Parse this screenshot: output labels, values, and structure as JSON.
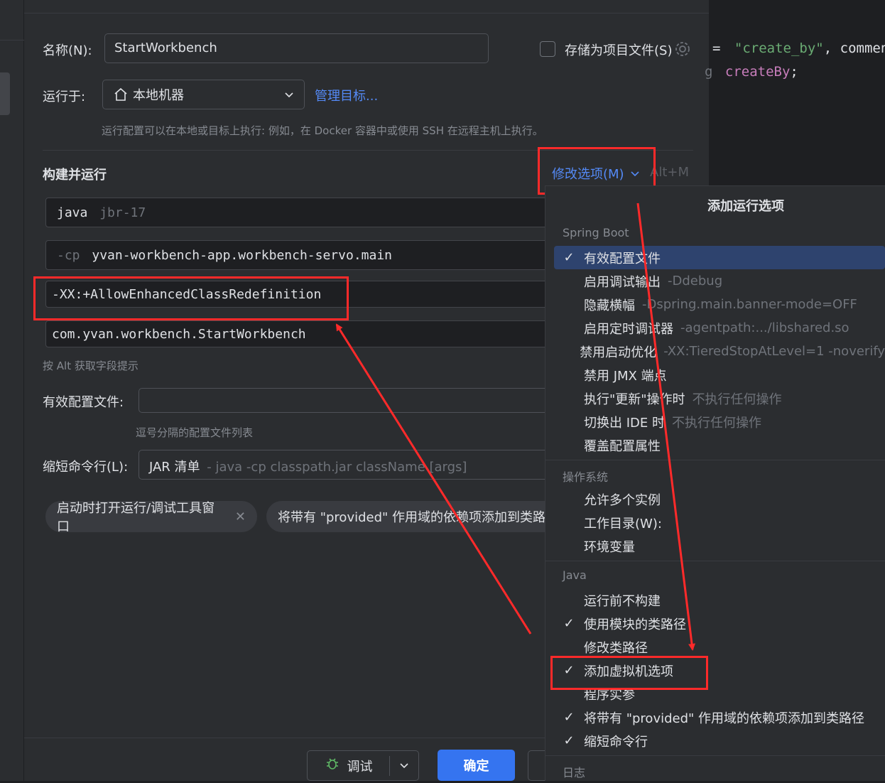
{
  "dialog": {
    "name_label": "名称(N):",
    "name_value": "StartWorkbench",
    "store_label": "存储为项目文件(S)",
    "run_on_label": "运行于:",
    "run_on_value": "本地机器",
    "manage_targets": "管理目标...",
    "run_on_hint": "运行配置可以在本地或目标上执行: 例如，在 Docker 容器中或使用 SSH 在远程主机上执行。",
    "build_run_title": "构建并运行",
    "modify_options": "修改选项(M)",
    "modify_shortcut": "Alt+M",
    "jdk_prefix": "java",
    "jdk_value": "jbr-17",
    "cp_prefix": "-cp",
    "cp_value": "yvan-workbench-app.workbench-servo.main",
    "vm_options": "-XX:+AllowEnhancedClassRedefinition",
    "main_class": "com.yvan.workbench.StartWorkbench",
    "alt_hint": "按 Alt 获取字段提示",
    "active_profiles_label": "有效配置文件:",
    "active_profiles_hint": "逗号分隔的配置文件列表",
    "shorten_label": "缩短命令行(L):",
    "shorten_value": "JAR 清单",
    "shorten_detail": "- java -cp classpath.jar className [args]",
    "chips": [
      "启动时打开运行/调试工具窗口",
      "将带有 \"provided\" 作用域的依赖项添加到类路径"
    ],
    "debug_button": "调试",
    "ok_button": "确定"
  },
  "code": {
    "line1_eq": "=",
    "line1_str": "\"create_by\"",
    "line1_rest": ", commen",
    "line2_prefix": "g",
    "line2_ident": "createBy",
    "line2_end": ";"
  },
  "popup": {
    "title": "添加运行选项",
    "sections": [
      {
        "header": "Spring Boot",
        "items": [
          {
            "label": "有效配置文件",
            "detail": "",
            "checked": true,
            "selected": true
          },
          {
            "label": "启用调试输出",
            "detail": "-Ddebug",
            "checked": false
          },
          {
            "label": "隐藏横幅",
            "detail": "-Dspring.main.banner-mode=OFF",
            "checked": false
          },
          {
            "label": "启用定时调试器",
            "detail": "-agentpath:.../libshared.so",
            "checked": false
          },
          {
            "label": "禁用启动优化",
            "detail": "-XX:TieredStopAtLevel=1 -noverify",
            "checked": false
          },
          {
            "label": "禁用 JMX 端点",
            "detail": "",
            "checked": false
          },
          {
            "label": "执行\"更新\"操作时",
            "detail": "不执行任何操作",
            "checked": false
          },
          {
            "label": "切换出 IDE 时",
            "detail": "不执行任何操作",
            "checked": false
          },
          {
            "label": "覆盖配置属性",
            "detail": "",
            "checked": false
          }
        ]
      },
      {
        "header": "操作系统",
        "items": [
          {
            "label": "允许多个实例",
            "detail": "",
            "checked": false
          },
          {
            "label": "工作目录(W):",
            "detail": "",
            "checked": false
          },
          {
            "label": "环境变量",
            "detail": "",
            "checked": false
          }
        ]
      },
      {
        "header": "Java",
        "items": [
          {
            "label": "运行前不构建",
            "detail": "",
            "checked": false
          },
          {
            "label": "使用模块的类路径",
            "detail": "",
            "checked": true
          },
          {
            "label": "修改类路径",
            "detail": "",
            "checked": false
          },
          {
            "label": "添加虚拟机选项",
            "detail": "",
            "checked": true
          },
          {
            "label": "程序实参",
            "detail": "",
            "checked": false
          },
          {
            "label": "将带有 \"provided\" 作用域的依赖项添加到类路径",
            "detail": "",
            "checked": true
          },
          {
            "label": "缩短命令行",
            "detail": "",
            "checked": true
          }
        ]
      },
      {
        "header": "日志",
        "items": []
      }
    ]
  },
  "colors": {
    "accent": "#548af7",
    "annotation_red": "#ff2a2a",
    "ok_button": "#3574f0"
  }
}
